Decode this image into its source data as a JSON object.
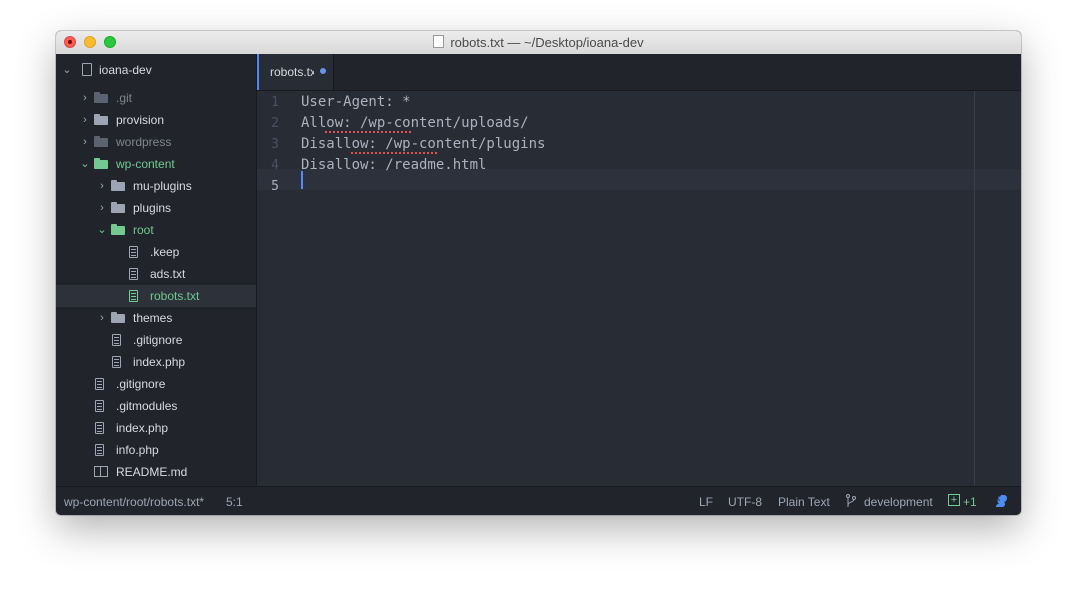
{
  "window": {
    "title": "robots.txt — ~/Desktop/ioana-dev"
  },
  "sidebar": {
    "root": {
      "label": "ioana-dev"
    },
    "items": [
      {
        "label": ".git",
        "type": "folder",
        "state": "collapsed",
        "depth": 1,
        "muted": true
      },
      {
        "label": "provision",
        "type": "folder",
        "state": "collapsed",
        "depth": 1
      },
      {
        "label": "wordpress",
        "type": "folder",
        "state": "collapsed",
        "depth": 1,
        "muted": true
      },
      {
        "label": "wp-content",
        "type": "folder",
        "state": "expanded",
        "depth": 1,
        "modified": true
      },
      {
        "label": "mu-plugins",
        "type": "folder",
        "state": "collapsed",
        "depth": 2
      },
      {
        "label": "plugins",
        "type": "folder",
        "state": "collapsed",
        "depth": 2
      },
      {
        "label": "root",
        "type": "folder",
        "state": "expanded",
        "depth": 2,
        "modified": true
      },
      {
        "label": ".keep",
        "type": "file",
        "depth": 3
      },
      {
        "label": "ads.txt",
        "type": "file",
        "depth": 3
      },
      {
        "label": "robots.txt",
        "type": "file",
        "depth": 3,
        "modified": true,
        "selected": true
      },
      {
        "label": "themes",
        "type": "folder",
        "state": "collapsed",
        "depth": 2
      },
      {
        "label": ".gitignore",
        "type": "file",
        "depth": 2
      },
      {
        "label": "index.php",
        "type": "file",
        "depth": 2
      },
      {
        "label": ".gitignore",
        "type": "file",
        "depth": 1
      },
      {
        "label": ".gitmodules",
        "type": "file",
        "depth": 1
      },
      {
        "label": "index.php",
        "type": "file",
        "depth": 1
      },
      {
        "label": "info.php",
        "type": "file",
        "depth": 1
      },
      {
        "label": "README.md",
        "type": "book",
        "depth": 1
      }
    ]
  },
  "tabs": [
    {
      "label": "robots.txt",
      "modified": true,
      "active": true
    }
  ],
  "editor": {
    "line_numbers": [
      "1",
      "2",
      "3",
      "4",
      "5"
    ],
    "active_line": 5,
    "lines": [
      "User-Agent: *",
      "Allow: /wp-content/uploads/",
      "Disallow: /wp-content/plugins",
      "Disallow: /readme.html",
      ""
    ]
  },
  "statusbar": {
    "file_path": "wp-content/root/robots.txt*",
    "cursor_position": "5:1",
    "line_ending": "LF",
    "encoding": "UTF-8",
    "grammar": "Plain Text",
    "branch": "development",
    "git_added": "+1"
  },
  "colors": {
    "accent": "#568af2",
    "modified_green": "#73c991",
    "editor_bg": "#282c34",
    "sidebar_bg": "#21252b",
    "spell_error": "#e05252"
  }
}
